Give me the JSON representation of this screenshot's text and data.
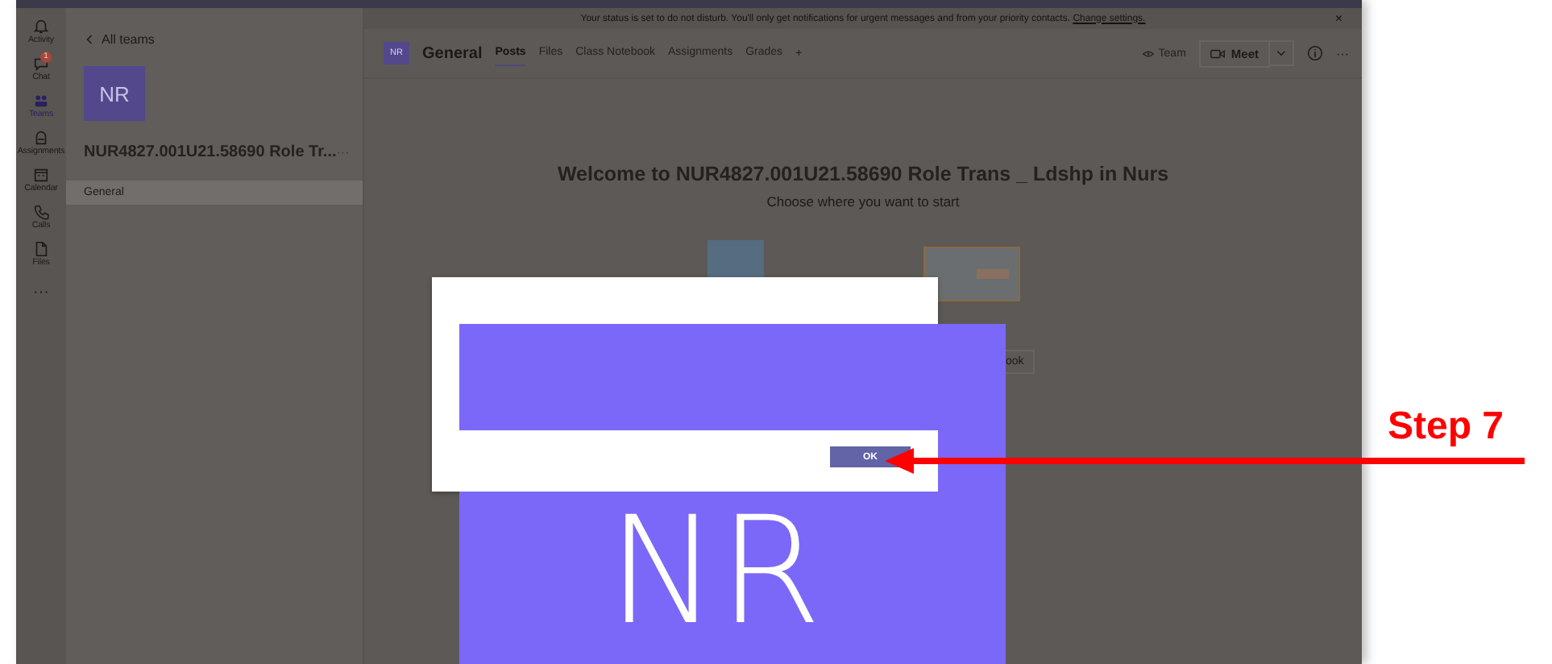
{
  "banner": {
    "text": "Your status is set to do not disturb. You'll only get notifications for urgent messages and from your priority contacts.",
    "link": "Change settings.",
    "close": "×"
  },
  "rail": [
    {
      "kind": "bell",
      "label": "Activity",
      "selected": false
    },
    {
      "kind": "chat",
      "label": "Chat",
      "selected": false,
      "badge": "1"
    },
    {
      "kind": "teams",
      "label": "Teams",
      "selected": true
    },
    {
      "kind": "bag",
      "label": "Assignments",
      "selected": false
    },
    {
      "kind": "calendar",
      "label": "Calendar",
      "selected": false
    },
    {
      "kind": "phone",
      "label": "Calls",
      "selected": false
    },
    {
      "kind": "file",
      "label": "Files",
      "selected": false
    }
  ],
  "rail_more": "···",
  "team_panel": {
    "back": "All teams",
    "avatar": "NR",
    "name": "NUR4827.001U21.58690 Role Tr...",
    "more": "···",
    "channels": [
      {
        "label": "General",
        "selected": true
      }
    ]
  },
  "header": {
    "avatar": "NR",
    "channel": "General",
    "tabs": [
      {
        "label": "Posts",
        "selected": true
      },
      {
        "label": "Files",
        "selected": false
      },
      {
        "label": "Class Notebook",
        "selected": false
      },
      {
        "label": "Assignments",
        "selected": false
      },
      {
        "label": "Grades",
        "selected": false
      }
    ],
    "add": "+",
    "team": "Team",
    "meet": "Meet",
    "more": "···"
  },
  "welcome": {
    "title": "Welcome to NUR4827.001U21.58690 Role Trans _ Ldshp in Nurs",
    "subtitle": "Choose where you want to start",
    "button": "ook"
  },
  "dialog": {
    "image_text": "NR",
    "button": "OK"
  },
  "annotation": {
    "label": "Step 7"
  }
}
